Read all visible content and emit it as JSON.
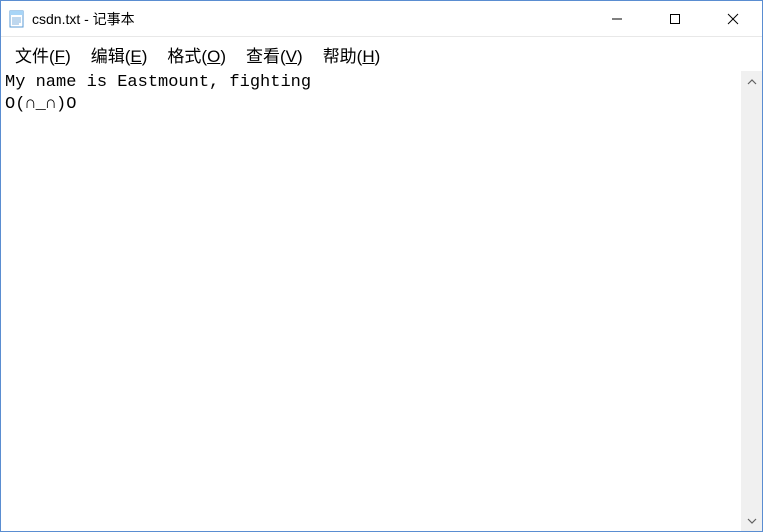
{
  "title": "csdn.txt - 记事本",
  "menus": {
    "file": {
      "text": "文件(",
      "mnemonic": "F",
      "suffix": ")"
    },
    "edit": {
      "text": "编辑(",
      "mnemonic": "E",
      "suffix": ")"
    },
    "format": {
      "text": "格式(",
      "mnemonic": "O",
      "suffix": ")"
    },
    "view": {
      "text": "查看(",
      "mnemonic": "V",
      "suffix": ")"
    },
    "help": {
      "text": "帮助(",
      "mnemonic": "H",
      "suffix": ")"
    }
  },
  "content": "My name is Eastmount, fighting\nO(∩_∩)O"
}
